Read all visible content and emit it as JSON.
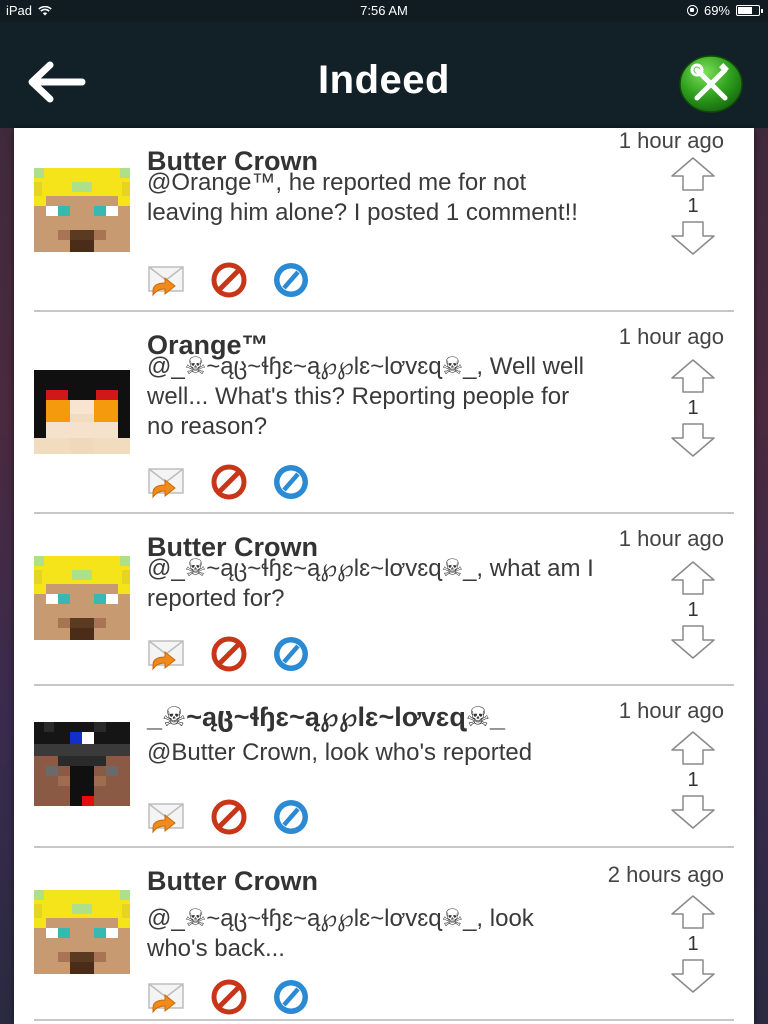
{
  "status_bar": {
    "device": "iPad",
    "time": "7:56 AM",
    "battery": "69%",
    "battery_level": 0.69
  },
  "nav": {
    "title": "Indeed",
    "back_icon": "back-arrow-icon",
    "settings_icon": "wrench-screwdriver-icon"
  },
  "comments": [
    {
      "author": "Butter Crown",
      "time": "1 hour ago",
      "text": "@Orange™, he reported me for not leaving him alone? I posted 1 comment!!",
      "score": "1",
      "avatar": "butter-crown"
    },
    {
      "author": "Orange™",
      "time": "1 hour ago",
      "text": "@_☠~ąც~ɬɧɛ~ą℘℘lɛ~lơvɛɋ☠_, Well well well... What's this? Reporting people for no reason?",
      "score": "1",
      "avatar": "orange"
    },
    {
      "author": "Butter Crown",
      "time": "1 hour ago",
      "text": "@_☠~ąც~ɬɧɛ~ą℘℘lɛ~lơvɛɋ☠_, what am I reported for?",
      "score": "1",
      "avatar": "butter-crown"
    },
    {
      "author": "_☠~ąც~ɬɧɛ~ą℘℘lɛ~lơvɛɋ☠_",
      "time": "1 hour ago",
      "text": "@Butter Crown, look who's reported",
      "score": "1",
      "avatar": "apple-lover"
    },
    {
      "author": "Butter Crown",
      "time": "2 hours ago",
      "text": "@_☠~ąც~ɬɧɛ~ą℘℘lɛ~lơvɛɋ☠_, look who's back...",
      "score": "1",
      "avatar": "butter-crown"
    }
  ],
  "action_icons": [
    "reply-envelope-icon",
    "block-icon",
    "report-icon"
  ],
  "colors": {
    "nav_background": "#122028",
    "settings_green": "#3fb02a",
    "block_red": "#c8361a",
    "report_blue": "#2a8ad4",
    "reply_orange": "#f08a1c"
  }
}
